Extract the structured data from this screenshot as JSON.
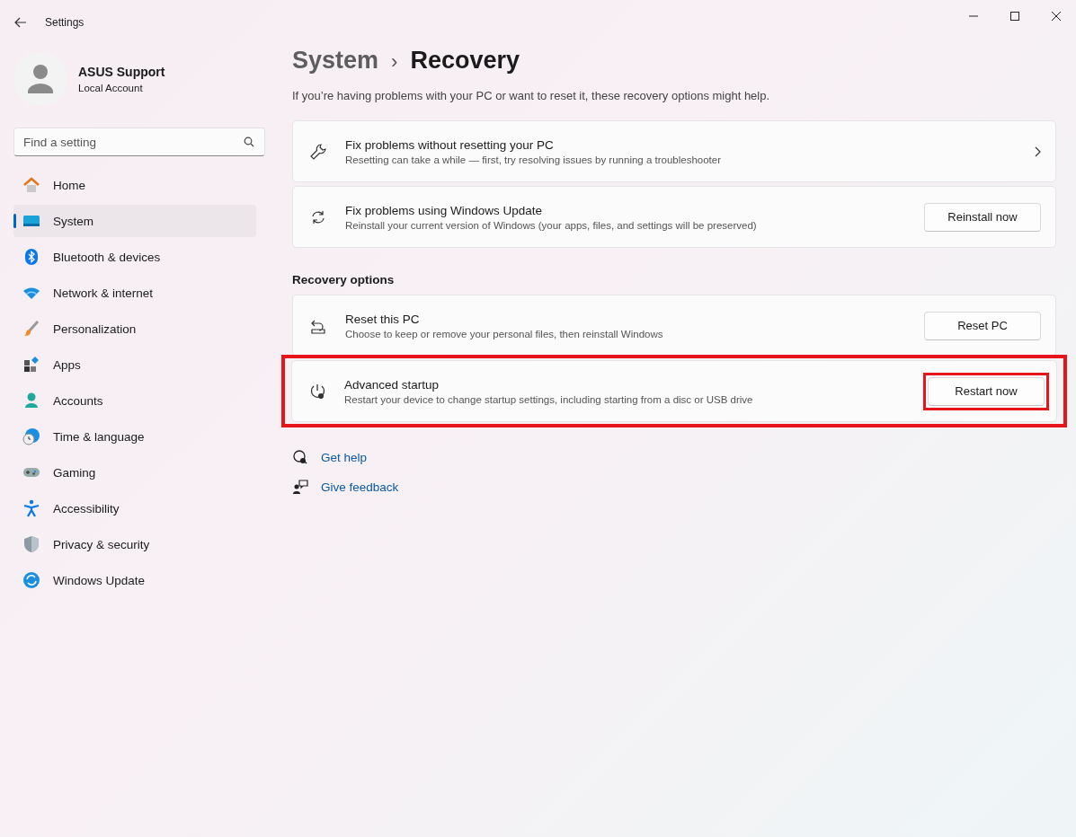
{
  "window": {
    "title": "Settings"
  },
  "account": {
    "name": "ASUS Support",
    "type": "Local Account"
  },
  "search": {
    "placeholder": "Find a setting"
  },
  "nav": [
    {
      "label": "Home",
      "selected": false
    },
    {
      "label": "System",
      "selected": true
    },
    {
      "label": "Bluetooth & devices",
      "selected": false
    },
    {
      "label": "Network & internet",
      "selected": false
    },
    {
      "label": "Personalization",
      "selected": false
    },
    {
      "label": "Apps",
      "selected": false
    },
    {
      "label": "Accounts",
      "selected": false
    },
    {
      "label": "Time & language",
      "selected": false
    },
    {
      "label": "Gaming",
      "selected": false
    },
    {
      "label": "Accessibility",
      "selected": false
    },
    {
      "label": "Privacy & security",
      "selected": false
    },
    {
      "label": "Windows Update",
      "selected": false
    }
  ],
  "breadcrumb": {
    "parent": "System",
    "separator": "›",
    "current": "Recovery"
  },
  "intro": "If you’re having problems with your PC or want to reset it, these recovery options might help.",
  "sections": [
    {
      "cards": [
        {
          "kind": "link",
          "title": "Fix problems without resetting your PC",
          "description": "Resetting can take a while — first, try resolving issues by running a troubleshooter",
          "highlighted": false
        },
        {
          "kind": "button",
          "title": "Fix problems using Windows Update",
          "description": "Reinstall your current version of Windows (your apps, files, and settings will be preserved)",
          "button": "Reinstall now",
          "highlighted": false,
          "button_highlighted": false
        }
      ]
    },
    {
      "heading": "Recovery options",
      "cards": [
        {
          "kind": "button",
          "title": "Reset this PC",
          "description": "Choose to keep or remove your personal files, then reinstall Windows",
          "button": "Reset PC",
          "highlighted": false,
          "button_highlighted": false
        },
        {
          "kind": "button",
          "title": "Advanced startup",
          "description": "Restart your device to change startup settings, including starting from a disc or USB drive",
          "button": "Restart now",
          "highlighted": true,
          "button_highlighted": true
        }
      ]
    }
  ],
  "links": [
    {
      "label": "Get help"
    },
    {
      "label": "Give feedback"
    }
  ]
}
